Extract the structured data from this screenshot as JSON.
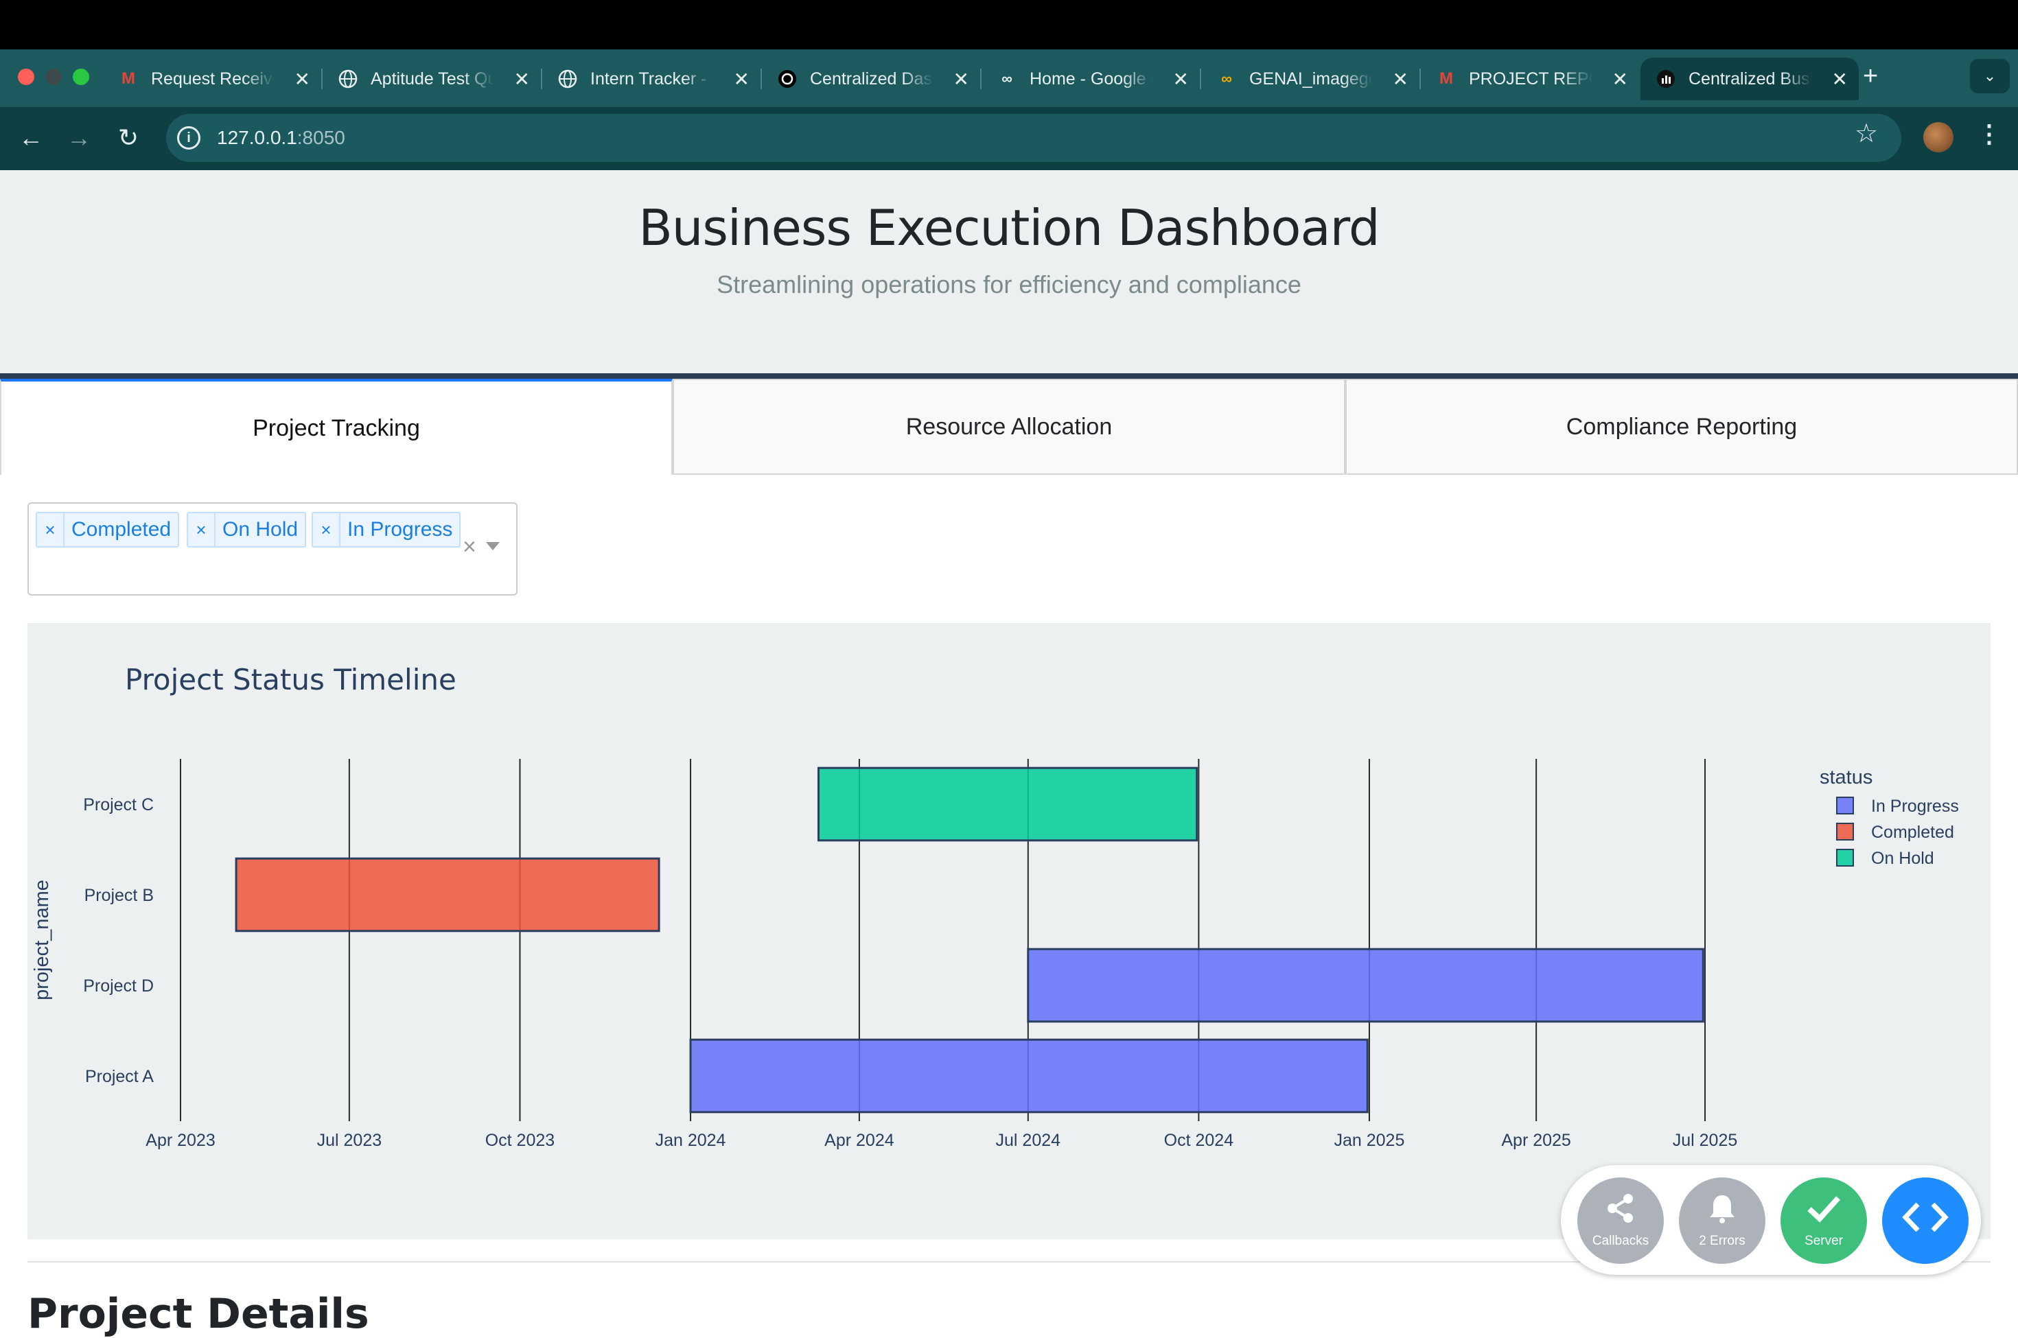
{
  "browser": {
    "tabs": [
      {
        "title": "Request Received",
        "icon": "gmail-icon"
      },
      {
        "title": "Aptitude Test Questions",
        "icon": "globe-icon"
      },
      {
        "title": "Intern Tracker - Sheet",
        "icon": "globe-icon"
      },
      {
        "title": "Centralized Dashboard",
        "icon": "openai-icon"
      },
      {
        "title": "Home - Google Colab",
        "icon": "colab-icon"
      },
      {
        "title": "GENAI_imagegen",
        "icon": "colab-icon"
      },
      {
        "title": "PROJECT REPORT",
        "icon": "gmail-icon"
      },
      {
        "title": "Centralized Business",
        "icon": "dash-icon"
      }
    ],
    "url_host": "127.0.0.1",
    "url_port": ":8050"
  },
  "header": {
    "title": "Business Execution Dashboard",
    "subtitle": "Streamlining operations for efficiency and compliance"
  },
  "page_tabs": [
    "Project Tracking",
    "Resource Allocation",
    "Compliance Reporting"
  ],
  "status_filter": {
    "selected": [
      "Completed",
      "On Hold",
      "In Progress"
    ]
  },
  "section_heading": "Project Details",
  "devtools": {
    "callbacks_label": "Callbacks",
    "errors_label": "2 Errors",
    "server_label": "Server"
  },
  "colors": {
    "in_progress": "#636efa",
    "completed": "#ef553b",
    "on_hold": "#00cc96",
    "accent": "#1975fa"
  },
  "chart_data": {
    "type": "timeline",
    "title": "Project Status Timeline",
    "ylabel": "project_name",
    "xlim": [
      "2023-04-01",
      "2025-07-01"
    ],
    "x_ticks": [
      "Apr 2023",
      "Jul 2023",
      "Oct 2023",
      "Jan 2024",
      "Apr 2024",
      "Jul 2024",
      "Oct 2024",
      "Jan 2025",
      "Apr 2025",
      "Jul 2025"
    ],
    "categories": [
      "Project C",
      "Project B",
      "Project D",
      "Project A"
    ],
    "legend_title": "status",
    "legend": [
      "In Progress",
      "Completed",
      "On Hold"
    ],
    "legend_position": "right",
    "tasks": [
      {
        "project": "Project C",
        "status": "On Hold",
        "start": "2024-03-10",
        "end": "2024-09-30"
      },
      {
        "project": "Project B",
        "status": "Completed",
        "start": "2023-05-01",
        "end": "2023-12-15"
      },
      {
        "project": "Project D",
        "status": "In Progress",
        "start": "2024-07-01",
        "end": "2025-06-30"
      },
      {
        "project": "Project A",
        "status": "In Progress",
        "start": "2024-01-01",
        "end": "2024-12-31"
      }
    ]
  }
}
